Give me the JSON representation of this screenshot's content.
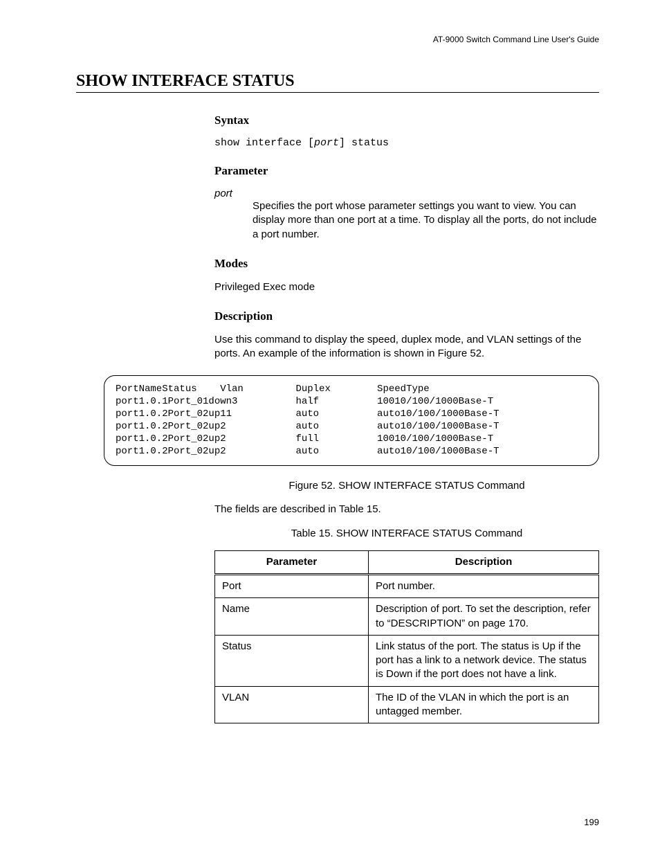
{
  "header": {
    "guide_title": "AT-9000 Switch Command Line User's Guide"
  },
  "page_title": "SHOW INTERFACE STATUS",
  "syntax": {
    "heading": "Syntax",
    "pre": "show interface [",
    "arg": "port",
    "post": "] status"
  },
  "parameter": {
    "heading": "Parameter",
    "name": "port",
    "desc": "Specifies the port whose parameter settings you want to view. You can display more than one port at a time. To display all the ports, do not include a port number."
  },
  "modes": {
    "heading": "Modes",
    "text": "Privileged Exec mode"
  },
  "description": {
    "heading": "Description",
    "text": "Use this command to display the speed, duplex mode, and VLAN settings of the ports. An example of the information is shown in Figure 52."
  },
  "example_lines": [
    "PortNameStatus    Vlan         Duplex        SpeedType",
    "port1.0.1Port_01down3          half          10010/100/1000Base-T",
    "port1.0.2Port_02up11           auto          auto10/100/1000Base-T",
    "port1.0.2Port_02up2            auto          auto10/100/1000Base-T",
    "port1.0.2Port_02up2            full          10010/100/1000Base-T",
    "port1.0.2Port_02up2            auto          auto10/100/1000Base-T"
  ],
  "figure_caption": "Figure 52. SHOW INTERFACE STATUS Command",
  "fields_intro": "The fields are described in Table 15.",
  "table_caption": "Table 15. SHOW INTERFACE STATUS Command",
  "table": {
    "head_param": "Parameter",
    "head_desc": "Description",
    "rows": [
      {
        "param": "Port",
        "desc": "Port number."
      },
      {
        "param": "Name",
        "desc": "Description of port. To set the description, refer to “DESCRIPTION” on page 170."
      },
      {
        "param": "Status",
        "desc": "Link status of the port. The status is Up if the port has a link to a network device. The status is Down if the port does not have a link."
      },
      {
        "param": "VLAN",
        "desc": "The ID of the VLAN in which the port is an untagged member."
      }
    ]
  },
  "page_number": "199"
}
